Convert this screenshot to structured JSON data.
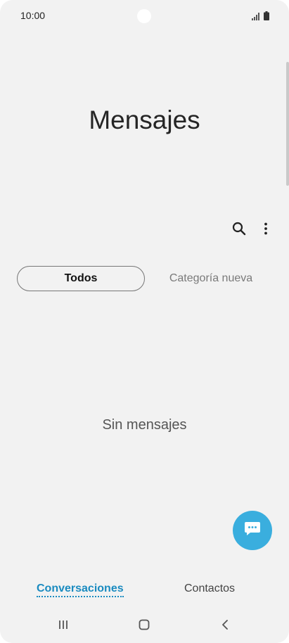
{
  "status_bar": {
    "time": "10:00",
    "icons": [
      "signal-icon",
      "battery-icon"
    ]
  },
  "app": {
    "title": "Mensajes"
  },
  "toolbar": {
    "icons": [
      "search-icon",
      "more-options-icon"
    ]
  },
  "tabs": [
    {
      "label": "Todos",
      "selected": true
    },
    {
      "label": "Categoría nueva",
      "selected": false
    }
  ],
  "empty_state": {
    "message": "Sin mensajes"
  },
  "fab": {
    "icon": "chat-bubble-icon",
    "color": "#3aaede"
  },
  "bottom_tabs": [
    {
      "label": "Conversaciones",
      "active": true
    },
    {
      "label": "Contactos",
      "active": false
    }
  ],
  "nav_bar": {
    "icons": [
      "recent-apps-icon",
      "home-icon",
      "back-icon"
    ]
  },
  "colors": {
    "background": "#f2f2f2",
    "accent": "#1a8bc0",
    "fab": "#3aaede"
  }
}
